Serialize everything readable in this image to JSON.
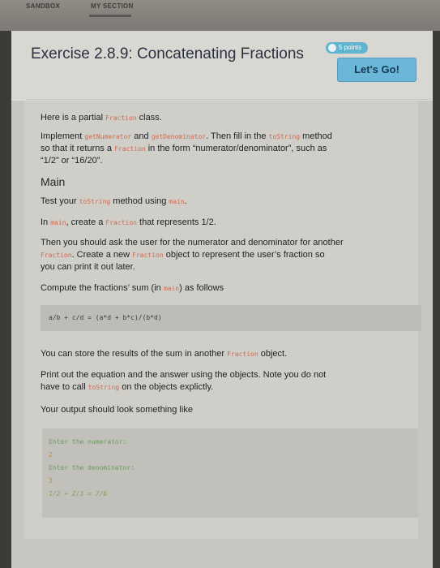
{
  "topnav": {
    "sandbox": "SANDBOX",
    "my_section": "MY SECTION"
  },
  "exercise": {
    "title": "Exercise 2.8.9: Concatenating Fractions",
    "points_badge": "5 points",
    "go_button": "Let's Go!"
  },
  "content": {
    "p1": {
      "pre": "Here is a partial ",
      "code": "Fraction",
      "post": " class."
    },
    "p2": {
      "a": "Implement ",
      "c1": "getNumerator",
      "b": " and ",
      "c2": "getDenominator",
      "c": ". Then fill in the ",
      "c3": "toString",
      "d": " method",
      "e": "so that it returns a ",
      "c4": "Fraction",
      "f": " in the form “numerator/denominator”, such as",
      "g": "“1/2” or “16/20”."
    },
    "main_heading": "Main",
    "p3": {
      "a": "Test your ",
      "c1": "toString",
      "b": " method using ",
      "c2": "main",
      "c": "."
    },
    "p4": {
      "a": "In ",
      "c1": "main",
      "b": ", create a ",
      "c2": "Fraction",
      "c": " that represents 1/2."
    },
    "p5": {
      "line1": "Then you should ask the user for the numerator and denominator for another",
      "c1": "Fraction",
      "a": ". Create a new ",
      "c2": "Fraction",
      "b": " object to represent the user’s fraction so",
      "line3": "you can print it out later."
    },
    "p6": {
      "a": "Compute the fractions’ sum (in ",
      "c1": "main",
      "b": ") as follows"
    },
    "formula": "a/b + c/d = (a*d + b*c)/(b*d)",
    "p7": {
      "a": "You can store the results of the sum in another ",
      "c1": "Fraction",
      "b": " object."
    },
    "p8": {
      "line1": "Print out the equation and the answer using the objects. Note you do not",
      "a": "have to call ",
      "c1": "toString",
      "b": " on the objects explictly."
    },
    "p9": "Your output should look something like",
    "output": {
      "prompt1": "Enter the numerator:",
      "value1": "2",
      "prompt2": "Enter the denominator:",
      "value2": "3",
      "result": "1/2 + 2/3 = 7/6"
    }
  }
}
